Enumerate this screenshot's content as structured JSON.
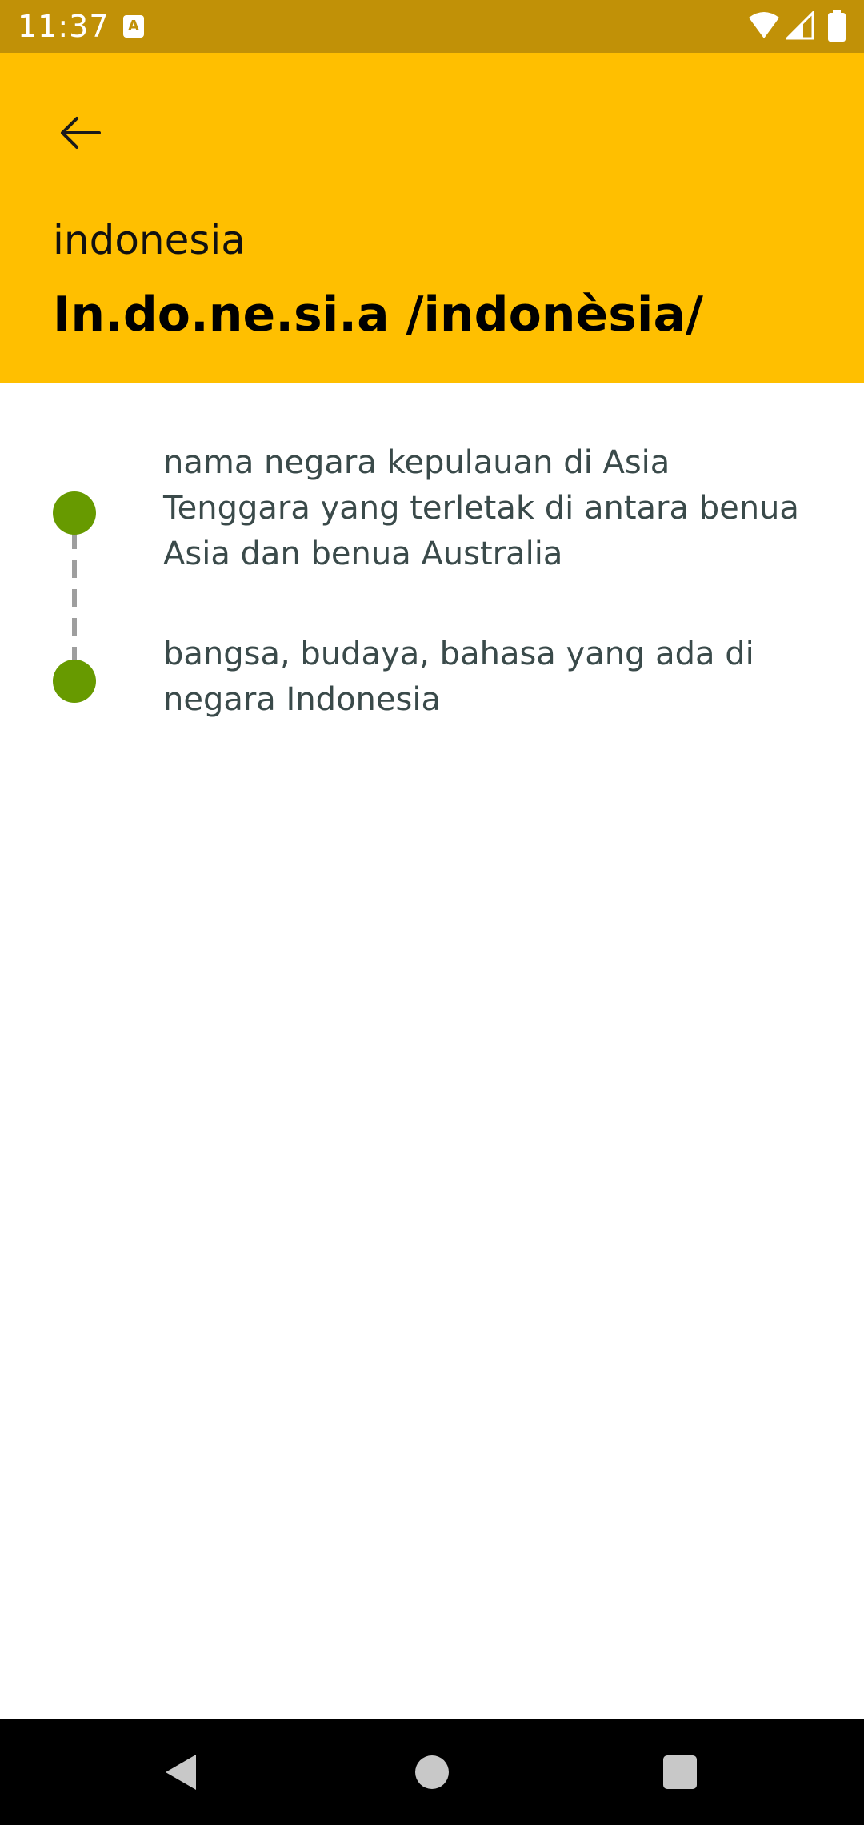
{
  "status_bar": {
    "time": "11:37",
    "notification_icon": "A",
    "icons": [
      "wifi-icon",
      "signal-icon",
      "battery-icon"
    ]
  },
  "header": {
    "back_icon": "arrow-left-icon",
    "word": "indonesia",
    "syllables": "In.do.ne.si.a /indonèsia/",
    "background_color": "#ffbf00"
  },
  "definitions": [
    {
      "text": "nama negara kepulauan di Asia Tenggara yang terletak di antara benua Asia dan benua Australia"
    },
    {
      "text": "bangsa, budaya, bahasa yang ada di negara Indonesia"
    }
  ],
  "colors": {
    "status_bar": "#c19107",
    "timeline_dot": "#679a00",
    "text": "#3a4a4a"
  },
  "nav_bar": {
    "icons": [
      "back-triangle-icon",
      "home-circle-icon",
      "recents-square-icon"
    ]
  }
}
